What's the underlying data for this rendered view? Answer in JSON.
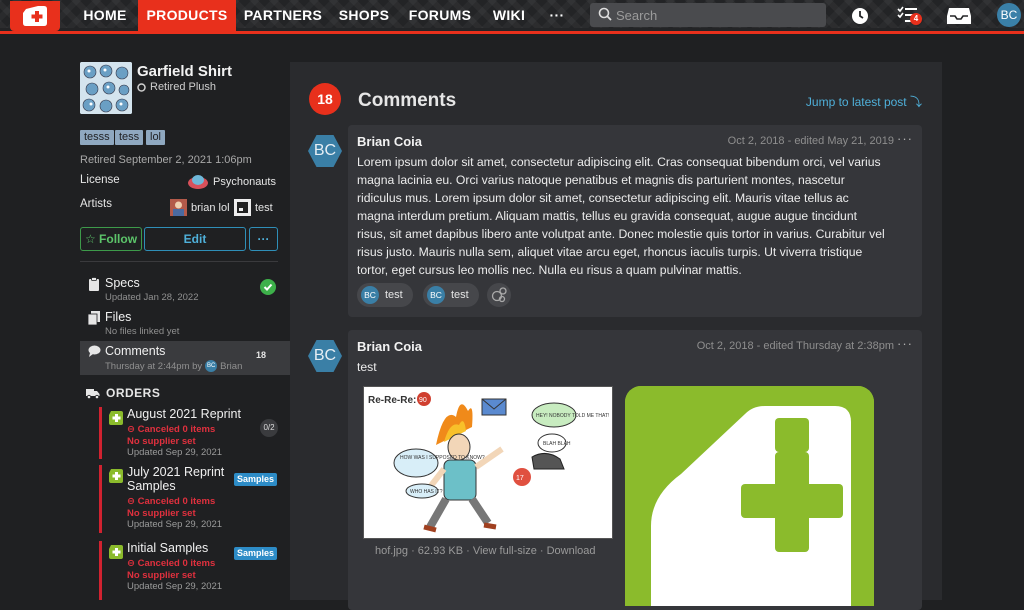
{
  "nav": {
    "links": [
      "HOME",
      "PRODUCTS",
      "PARTNERS",
      "SHOPS",
      "FORUMS",
      "WIKI",
      "···"
    ],
    "active": "PRODUCTS",
    "search_placeholder": "Search",
    "notification_count": "4",
    "avatar_initials": "BC",
    "accent": "#e8301c"
  },
  "product": {
    "title": "Garfield Shirt",
    "status": "Retired Plush",
    "tags": [
      "tesss",
      "tess",
      "lol"
    ],
    "retired": "Retired September 2, 2021 1:06pm",
    "license_label": "License",
    "license_value": "Psychonauts",
    "artists_label": "Artists",
    "artists": [
      "brian lol",
      "test"
    ],
    "follow_label": "Follow",
    "edit_label": "Edit",
    "more_label": "···"
  },
  "sidebar": {
    "items": [
      {
        "label": "Specs",
        "sub": "Updated Jan 28, 2022"
      },
      {
        "label": "Files",
        "sub": "No files linked yet"
      },
      {
        "label": "Comments",
        "sub": "Thursday at 2:44pm by",
        "sub_user": "Brian",
        "sub_avatar": "BC",
        "count": "18"
      }
    ],
    "orders_header": "ORDERS",
    "orders": [
      {
        "title": "August 2021 Reprint",
        "status": "Canceled 0 items",
        "supplier": "No supplier set",
        "date": "Updated Sep 29, 2021",
        "pill": "0/2"
      },
      {
        "title": "July 2021 Reprint Samples",
        "status": "Canceled 0 items",
        "supplier": "No supplier set",
        "date": "Updated Sep 29, 2021",
        "badge": "Samples"
      },
      {
        "title": "Initial Samples",
        "status": "Canceled 0 items",
        "supplier": "No supplier set",
        "date": "Updated Sep 29, 2021",
        "badge": "Samples"
      }
    ]
  },
  "main": {
    "count": "18",
    "title": "Comments",
    "jump": "Jump to latest post",
    "comments": [
      {
        "avatar": "BC",
        "author": "Brian Coia",
        "date": "Oct 2, 2018 - edited May 21, 2019",
        "body": "Lorem ipsum dolor sit amet, consectetur adipiscing elit. Cras consequat bibendum orci, vel varius magna lacinia eu. Orci varius natoque penatibus et magnis dis parturient montes, nascetur ridiculus mus. Lorem ipsum dolor sit amet, consectetur adipiscing elit. Mauris vitae tellus ac magna interdum pretium. Aliquam mattis, tellus eu gravida consequat, augue augue tincidunt risus, sit amet dapibus libero ante volutpat ante. Donec molestie quis tortor in varius. Curabitur vel risus justo. Mauris nulla sem, aliquet vitae arcu eget, rhoncus iaculis turpis. Ut viverra tristique tortor, eget cursus leo mollis nec. Nulla eu risus a quam pulvinar mattis.",
        "reactions": [
          {
            "avatar": "BC",
            "label": "test"
          },
          {
            "avatar": "BC",
            "label": "test"
          }
        ]
      },
      {
        "avatar": "BC",
        "author": "Brian Coia",
        "date": "Oct 2, 2018 - edited Thursday at 2:38pm",
        "body": "test",
        "attachment_caption": "hof.jpg · 62.93 KB · View full-size · Download",
        "cartoon_text": {
          "rerere": "Re-Re-Re:",
          "bubble1": "HOW WAS I SUPPOSED TO KNOW?",
          "bubble2": "WHO HAS IT?",
          "bubble3": "HEY! NOBODY TOLD ME THAT!",
          "bubble4": "BLAH BLAH",
          "badge": "90",
          "badge2": "17"
        }
      }
    ]
  }
}
